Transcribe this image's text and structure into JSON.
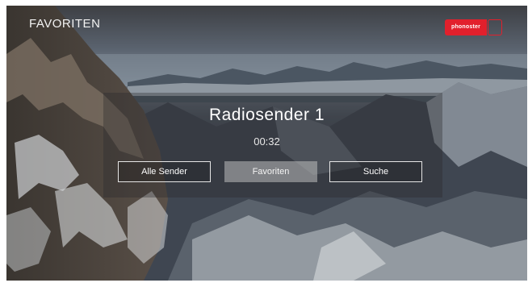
{
  "header": {
    "title": "FAVORITEN"
  },
  "logo": {
    "text": "phonoster"
  },
  "player": {
    "station": "Radiosender 1",
    "time": "00:32"
  },
  "buttons": [
    {
      "label": "Alle Sender",
      "selected": false
    },
    {
      "label": "Favoriten",
      "selected": true
    },
    {
      "label": "Suche",
      "selected": false
    }
  ],
  "colors": {
    "brand": "#e2202c",
    "text": "#ffffff",
    "selected_button": "#bebebe"
  }
}
